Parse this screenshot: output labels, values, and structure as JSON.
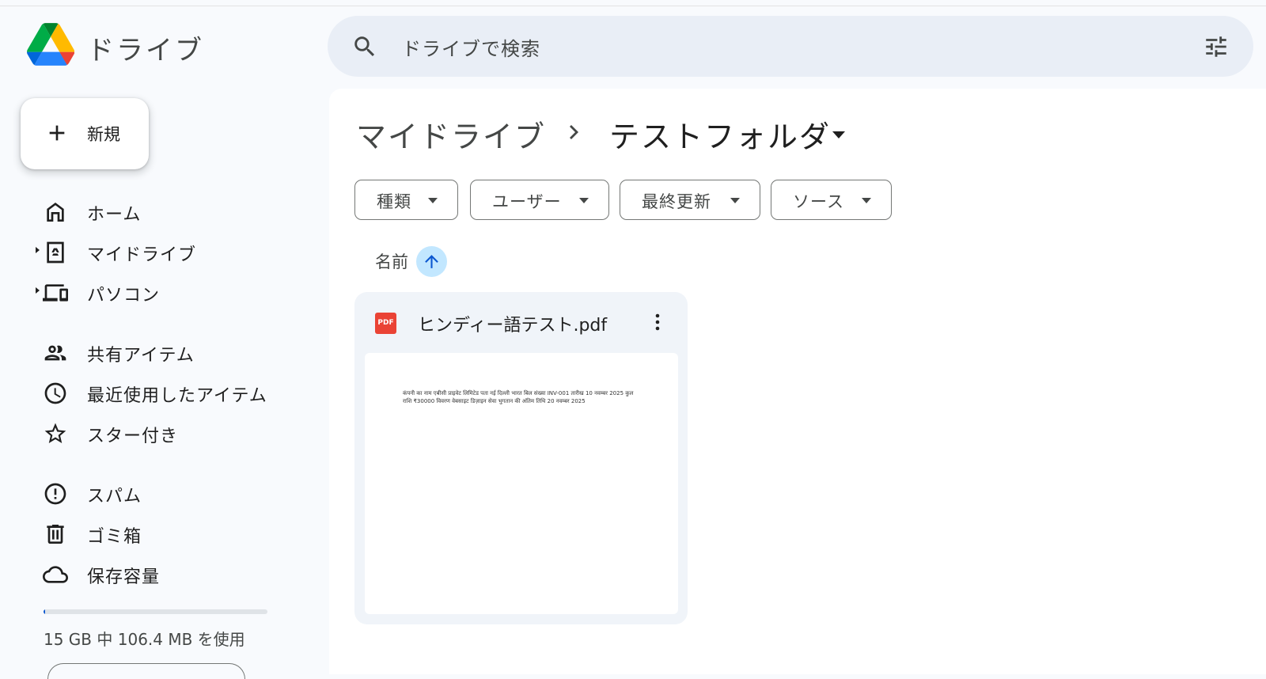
{
  "app": {
    "title": "ドライブ"
  },
  "search": {
    "placeholder": "ドライブで検索"
  },
  "sidebar": {
    "new_label": "新規",
    "items": [
      {
        "label": "ホーム",
        "icon": "home-icon"
      },
      {
        "label": "マイドライブ",
        "icon": "my-drive-icon"
      },
      {
        "label": "パソコン",
        "icon": "computers-icon"
      },
      {
        "label": "共有アイテム",
        "icon": "shared-icon"
      },
      {
        "label": "最近使用したアイテム",
        "icon": "clock-icon"
      },
      {
        "label": "スター付き",
        "icon": "star-icon"
      },
      {
        "label": "スパム",
        "icon": "spam-icon"
      },
      {
        "label": "ゴミ箱",
        "icon": "trash-icon"
      },
      {
        "label": "保存容量",
        "icon": "cloud-icon"
      }
    ],
    "storage": {
      "text": "15 GB 中 106.4 MB を使用",
      "used_fraction": 0.007
    }
  },
  "breadcrumb": {
    "root": "マイドライブ",
    "current": "テストフォルダ"
  },
  "filters": [
    {
      "label": "種類"
    },
    {
      "label": "ユーザー"
    },
    {
      "label": "最終更新"
    },
    {
      "label": "ソース"
    }
  ],
  "sort": {
    "label": "名前"
  },
  "files": [
    {
      "name": "ヒンディー語テスト.pdf",
      "type_badge": "PDF",
      "preview_text": "कंपनी का नाम एबीसी प्राइवेट लिमिटेड पता नई दिल्ली भारत बिल संख्या INV-001 तारीख 10 नवम्बर 2025 कुल राशि ₹30000 विवरण वेबसाइट डिज़ाइन सेवा भुगतान की अंतिम तिथि 20 नवम्बर 2025"
    }
  ],
  "colors": {
    "accent": "#0b57d0",
    "sort_bg": "#c2e7ff",
    "search_bg": "#e9eef6",
    "pdf_red": "#ea4335"
  }
}
